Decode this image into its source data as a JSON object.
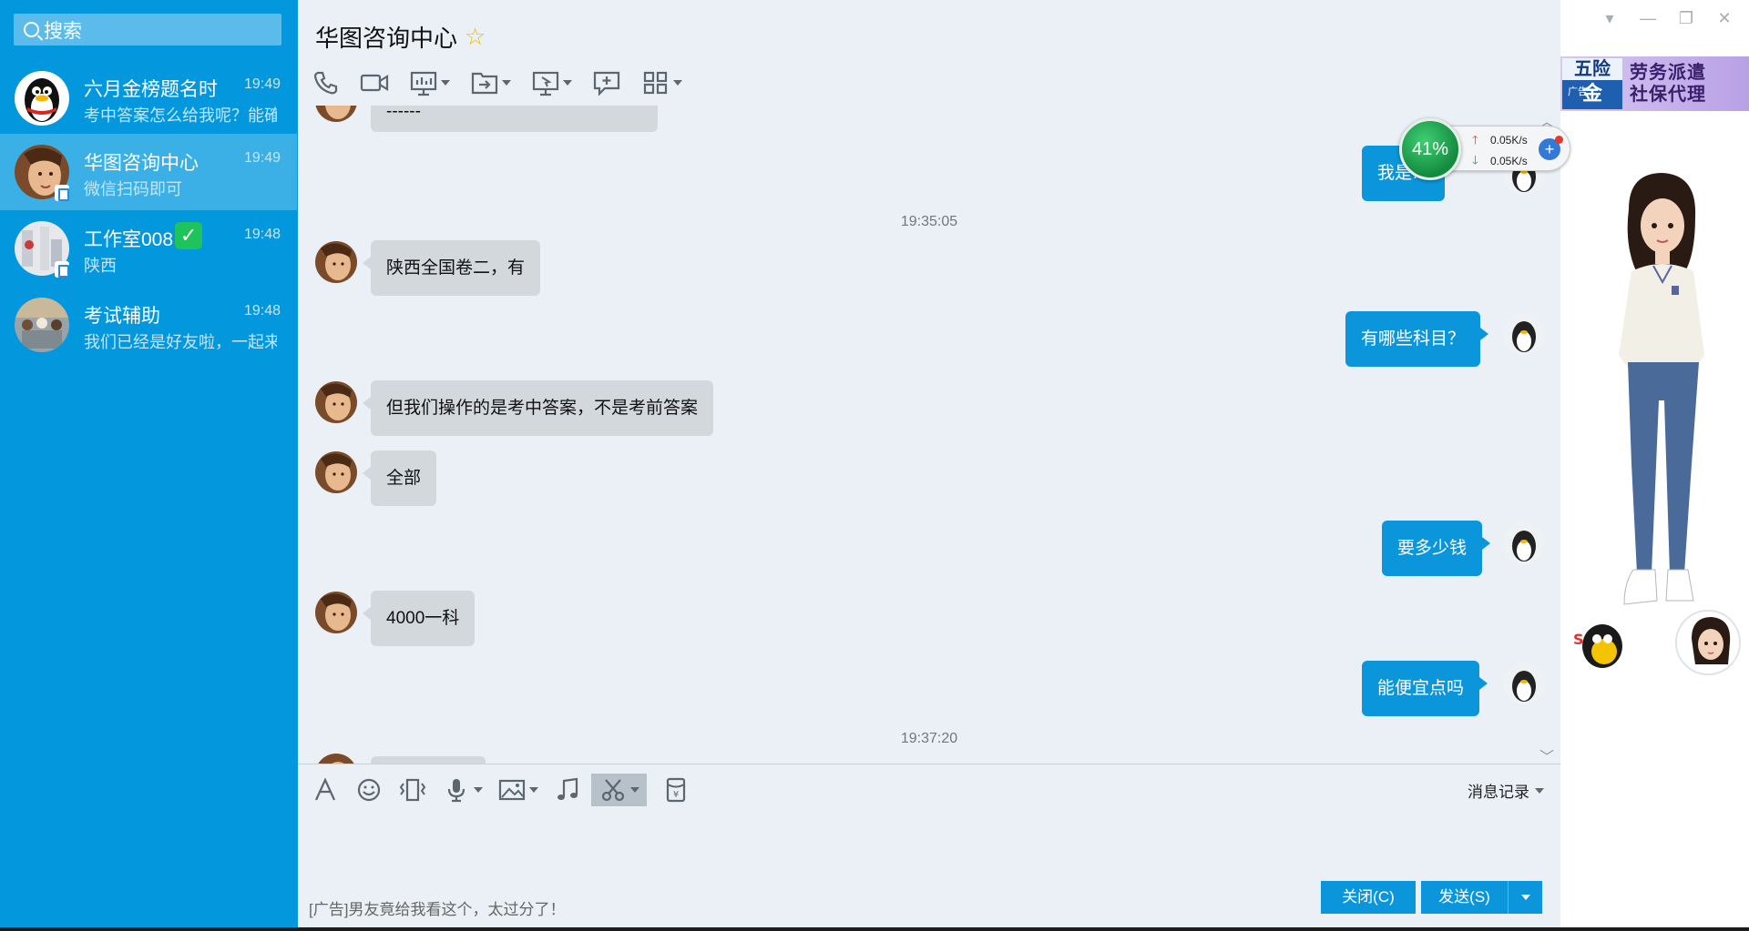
{
  "sidebar": {
    "search_placeholder": "搜索",
    "conversations": [
      {
        "name": "六月金榜题名时",
        "time": "19:49",
        "preview": "考中答案怎么给我呢？能確"
      },
      {
        "name": "华图咨询中心",
        "time": "19:49",
        "preview": "微信扫码即可"
      },
      {
        "name": "工作室008",
        "time": "19:48",
        "preview": "陕西"
      },
      {
        "name": "考试辅助",
        "time": "19:48",
        "preview": "我们已经是好友啦，一起来"
      }
    ]
  },
  "chat": {
    "title": "华图咨询中心",
    "messages": [
      {
        "type": "in",
        "text": "------"
      },
      {
        "type": "out",
        "text": "我是…"
      },
      {
        "type": "time",
        "text": "19:35:05"
      },
      {
        "type": "in",
        "text": "陕西全国卷二，有"
      },
      {
        "type": "out",
        "text": "有哪些科目？"
      },
      {
        "type": "in",
        "text": "但我们操作的是考中答案，不是考前答案"
      },
      {
        "type": "in",
        "text": "全部"
      },
      {
        "type": "out",
        "text": "要多少钱"
      },
      {
        "type": "in",
        "text": "4000一科"
      },
      {
        "type": "out",
        "text": "能便宜点吗"
      },
      {
        "type": "time",
        "text": "19:37:20"
      }
    ],
    "history_label": "消息记录",
    "ad_text": "[广告]男友竟给我看这个，太过分了！",
    "close_label": "关闭(C)",
    "send_label": "发送(S)"
  },
  "net_monitor": {
    "percent": "41%",
    "upload": "0.05K/s",
    "download": "0.05K/s"
  },
  "ad_banner": {
    "left_top": "五险",
    "left_bottom": "金",
    "ad_tag": "广告",
    "right_line1": "劳务派遣",
    "right_line2": "社保代理"
  },
  "colors": {
    "sidebar_bg": "#0397de",
    "active_item": "#3ab0e7",
    "chat_bg": "#eaf0f5",
    "bubble_out": "#0b96dc",
    "bubble_in": "#d3d8dd"
  }
}
